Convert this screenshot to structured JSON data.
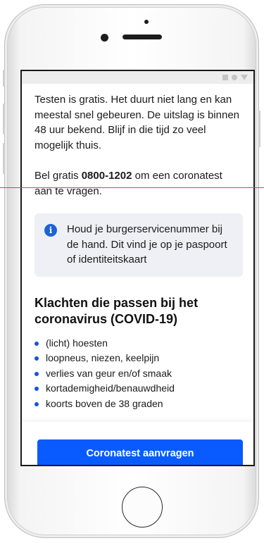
{
  "content": {
    "intro_text": "Testen is gratis. Het duurt niet lang en kan meestal snel gebeuren. De uitslag is binnen 48 uur bekend. Blijf in die tijd zo veel mogelijk thuis.",
    "call_prefix": "Bel gratis ",
    "call_number": "0800-1202",
    "call_suffix": " om een coronatest aan te vragen.",
    "info_box": {
      "icon": "info-icon",
      "text": "Houd je burgerservicenummer bij de hand. Dit vind je op je paspoort of identiteitskaart"
    },
    "symptoms_title": "Klachten die passen bij het coronavirus (COVID-19)",
    "symptoms": [
      "(licht) hoesten",
      "loopneus, niezen, keelpijn",
      "verlies van geur en/of smaak",
      "kortademigheid/benauwdheid",
      "koorts boven de 38 graden"
    ]
  },
  "actions": {
    "primary_button_label": "Coronatest aanvragen"
  },
  "colors": {
    "accent": "#0a5bff",
    "bullet": "#1552e6",
    "info_box_bg": "#eef0f5",
    "guide_line": "#e0413a"
  }
}
